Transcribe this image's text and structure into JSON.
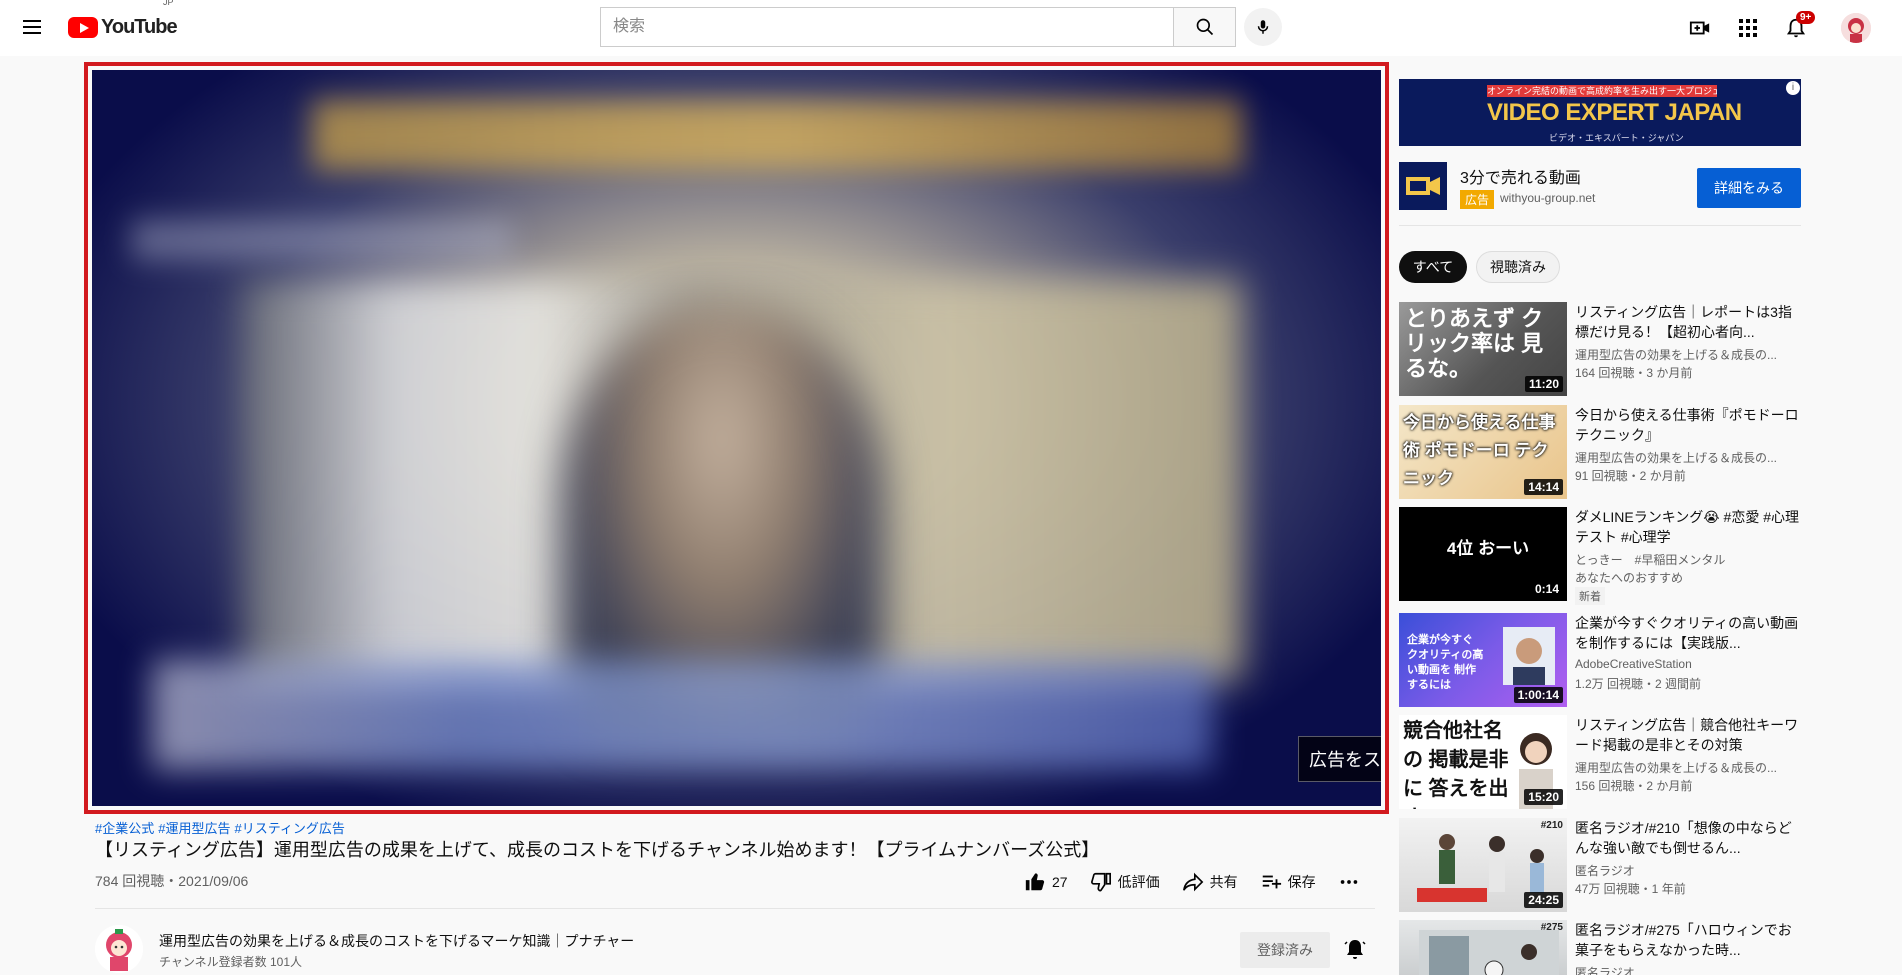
{
  "header": {
    "logo_text": "YouTube",
    "region": "JP",
    "search_placeholder": "検索",
    "notification_count": "9+"
  },
  "player": {
    "skip_label": "広告をスキップ"
  },
  "video": {
    "hashtags": [
      "#企業公式",
      "#運用型広告",
      "#リスティング広告"
    ],
    "title": "【リスティング広告】運用型広告の成果を上げて、成長のコストを下げるチャンネル始めます！【プライムナンバーズ公式】",
    "views_date": "784 回視聴・2021/09/06",
    "likes": "27",
    "dislike_label": "低評価",
    "share_label": "共有",
    "save_label": "保存"
  },
  "channel": {
    "name": "運用型広告の効果を上げる＆成長のコストを下げるマーケ知識｜プナチャー",
    "subscribers": "チャンネル登録者数 101人",
    "subscribe_label": "登録済み"
  },
  "ad": {
    "banner_top": "オンライン完結の動画で高成約率を生み出す一大プロジェクト!",
    "banner_main": "VIDEO EXPERT JAPAN",
    "banner_sub": "ビデオ・エキスパート・ジャパン",
    "title": "3分で売れる動画",
    "badge": "広告",
    "domain": "withyou-group.net",
    "cta": "詳細をみる"
  },
  "chips": {
    "all": "すべて",
    "watched": "視聴済み"
  },
  "recommendations": [
    {
      "title": "リスティング広告｜レポートは3指標だけ見る！【超初心者向...",
      "channel": "運用型広告の効果を上げる＆成長の...",
      "meta": "164 回視聴・3 か月前",
      "duration": "11:20",
      "thumb_text": "とりあえず クリック率は 見るな。"
    },
    {
      "title": "今日から使える仕事術『ポモドーロテクニック』",
      "channel": "運用型広告の効果を上げる＆成長の...",
      "meta": "91 回視聴・2 か月前",
      "duration": "14:14",
      "thumb_text": "今日から使える仕事術 ポモドーロ テクニック"
    },
    {
      "title": "ダメLINEランキング😭 #恋愛 #心理テスト #心理学",
      "channel": "とっきー　#早稲田メンタル",
      "meta": "あなたへのおすすめ",
      "badge": "新着",
      "duration": "0:14",
      "thumb_text": "4位 おーい"
    },
    {
      "title": "企業が今すぐクオリティの高い動画を制作するには【実践版...",
      "channel": "AdobeCreativeStation",
      "meta": "1.2万 回視聴・2 週間前",
      "duration": "1:00:14",
      "thumb_text": "企業が今すぐ クオリティの高い動画を 制作するには"
    },
    {
      "title": "リスティング広告｜競合他社キーワード掲載の是非とその対策",
      "channel": "運用型広告の効果を上げる＆成長の...",
      "meta": "156 回視聴・2 か月前",
      "duration": "15:20",
      "thumb_text": "競合他社名の 掲載是非に 答えを出す。"
    },
    {
      "title": "匿名ラジオ/#210「想像の中ならどんな強い敵でも倒せるん...",
      "channel": "匿名ラジオ",
      "meta": "47万 回視聴・1 年前",
      "duration": "24:25",
      "thumb_text": "#210"
    },
    {
      "title": "匿名ラジオ/#275「ハロウィンでお菓子をもらえなかった時...",
      "channel": "匿名ラジオ",
      "meta": "",
      "duration": "",
      "thumb_text": "#275"
    }
  ]
}
